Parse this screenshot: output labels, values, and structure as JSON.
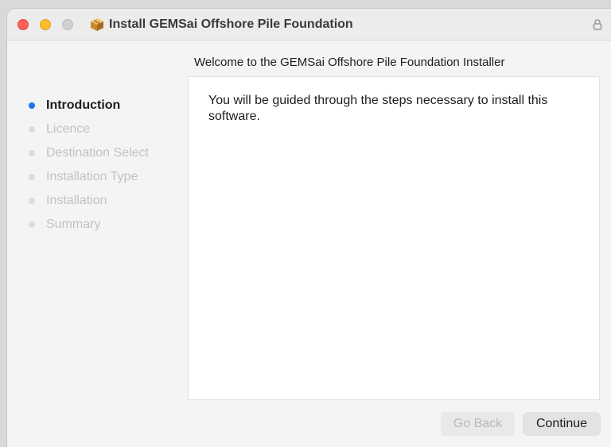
{
  "window": {
    "title": "Install GEMSai Offshore Pile Foundation"
  },
  "heading": "Welcome to the GEMSai Offshore Pile Foundation Installer",
  "steps": [
    {
      "label": "Introduction",
      "state": "active"
    },
    {
      "label": "Licence",
      "state": "pending"
    },
    {
      "label": "Destination Select",
      "state": "pending"
    },
    {
      "label": "Installation Type",
      "state": "pending"
    },
    {
      "label": "Installation",
      "state": "pending"
    },
    {
      "label": "Summary",
      "state": "pending"
    }
  ],
  "content": {
    "body": "You will be guided through the steps necessary to install this software."
  },
  "buttons": {
    "back_label": "Go Back",
    "back_enabled": false,
    "continue_label": "Continue"
  },
  "icons": {
    "app": "package-icon",
    "lock": "lock-icon"
  },
  "colors": {
    "active_step": "#1f74e8",
    "close": "#fe5f57",
    "minimize": "#febc2e",
    "zoom_inactive": "#d0d0d0"
  }
}
